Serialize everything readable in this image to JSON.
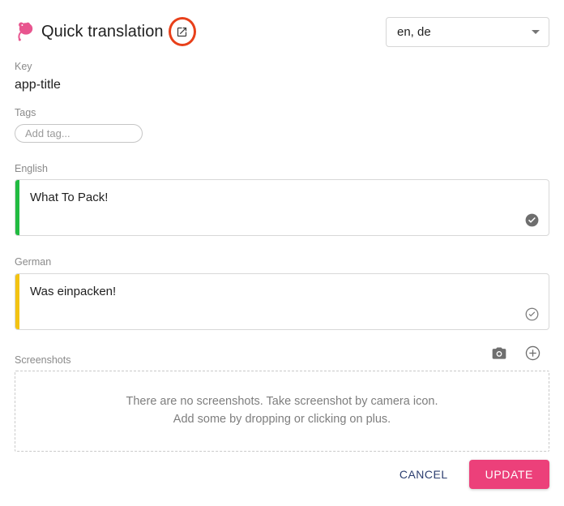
{
  "header": {
    "logo_icon": "tolgee-logo-icon",
    "title": "Quick translation",
    "external_link_icon": "external-link-icon",
    "highlight_color": "#e8401a"
  },
  "language_select": {
    "value": "en, de",
    "caret_icon": "chevron-down-icon",
    "options": [
      "en, de"
    ]
  },
  "key": {
    "label": "Key",
    "value": "app-title"
  },
  "tags": {
    "label": "Tags",
    "placeholder": "Add tag...",
    "value": ""
  },
  "translations": [
    {
      "label": "English",
      "value": "What To Pack!",
      "state_color": "#21bb41",
      "state": "translated",
      "check_icon": "check-circle-filled-icon"
    },
    {
      "label": "German",
      "value": "Was einpacken!",
      "state_color": "#f3c312",
      "state": "untranslated-reviewed",
      "check_icon": "check-circle-outline-icon"
    }
  ],
  "screenshots": {
    "label": "Screenshots",
    "camera_icon": "camera-icon",
    "add_icon": "plus-circle-icon",
    "empty_line1": "There are no screenshots. Take screenshot by camera icon.",
    "empty_line2": "Add some by dropping or clicking on plus."
  },
  "actions": {
    "cancel_label": "CANCEL",
    "update_label": "UPDATE",
    "update_color": "#ec407a"
  }
}
